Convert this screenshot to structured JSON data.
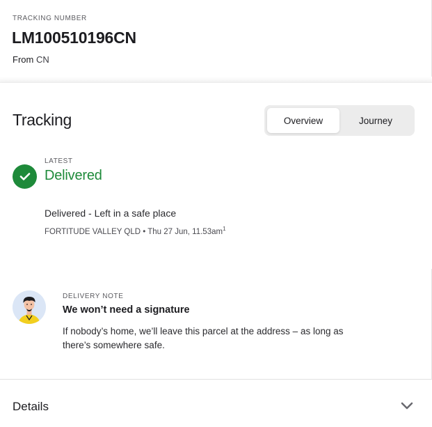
{
  "header": {
    "tracking_label": "TRACKING NUMBER",
    "tracking_number": "LM100510196CN",
    "from_prefix": "From",
    "from_country": "CN"
  },
  "tracking": {
    "title": "Tracking",
    "tabs": [
      {
        "label": "Overview",
        "active": true
      },
      {
        "label": "Journey",
        "active": false
      }
    ],
    "latest_label": "LATEST",
    "status": "Delivered",
    "status_color": "#1e8a3a",
    "status_icon": "check-circle-icon",
    "event_description": "Delivered - Left in a safe place",
    "event_meta": "FORTITUDE VALLEY QLD • Thu 27 Jun, 11.53am",
    "event_footnote": "1"
  },
  "delivery_note": {
    "label": "DELIVERY NOTE",
    "title": "We won’t need a signature",
    "body": "If nobody’s home, we’ll leave this parcel at the address – as long as there’s somewhere safe.",
    "avatar_icon": "person-avatar-icon"
  },
  "details": {
    "title": "Details",
    "expand_icon": "chevron-down-icon"
  }
}
